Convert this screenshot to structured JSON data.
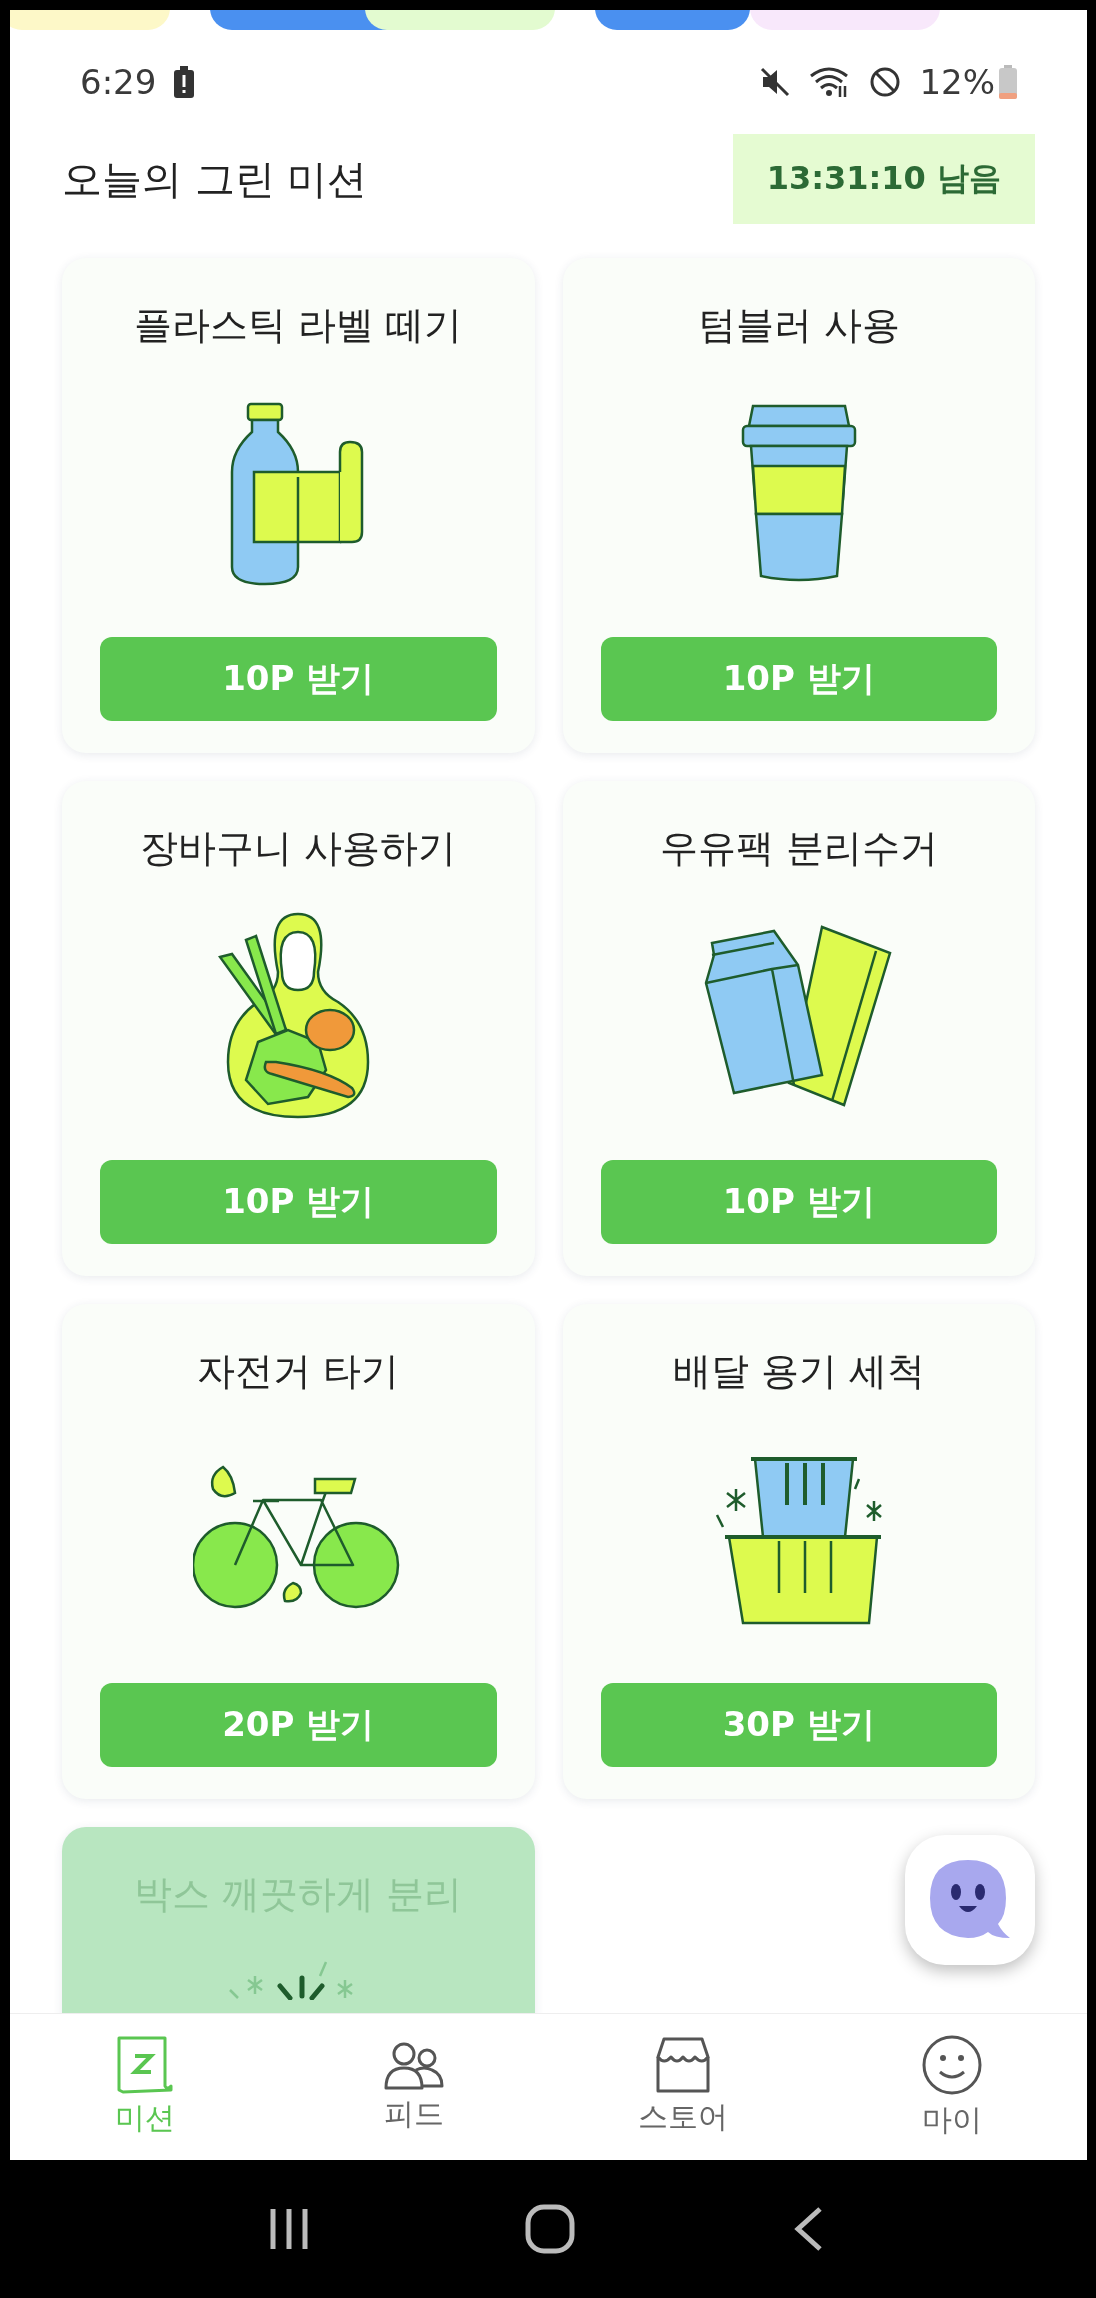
{
  "status_bar": {
    "time": "6:29",
    "battery_percent": "12%"
  },
  "header": {
    "title": "오늘의 그린 미션",
    "timer": "13:31:10 남음"
  },
  "missions": [
    {
      "title": "플라스틱 라벨 떼기",
      "kind": "bottle",
      "reward": "10P 받기",
      "done": false
    },
    {
      "title": "텀블러 사용",
      "kind": "tumbler",
      "reward": "10P 받기",
      "done": false
    },
    {
      "title": "장바구니 사용하기",
      "kind": "bag",
      "reward": "10P 받기",
      "done": false
    },
    {
      "title": "우유팩 분리수거",
      "kind": "carton",
      "reward": "10P 받기",
      "done": false
    },
    {
      "title": "자전거 타기",
      "kind": "bicycle",
      "reward": "20P 받기",
      "done": false
    },
    {
      "title": "배달 용기 세척",
      "kind": "container",
      "reward": "30P 받기",
      "done": false
    },
    {
      "title": "박스 깨끗하게 분리",
      "kind": "sparkle",
      "done": true
    }
  ],
  "bottom_nav": [
    {
      "label": "미션",
      "kind": "mission",
      "selected": true
    },
    {
      "label": "피드",
      "kind": "feed",
      "selected": false
    },
    {
      "label": "스토어",
      "kind": "store",
      "selected": false
    },
    {
      "label": "마이",
      "kind": "my",
      "selected": false
    }
  ]
}
